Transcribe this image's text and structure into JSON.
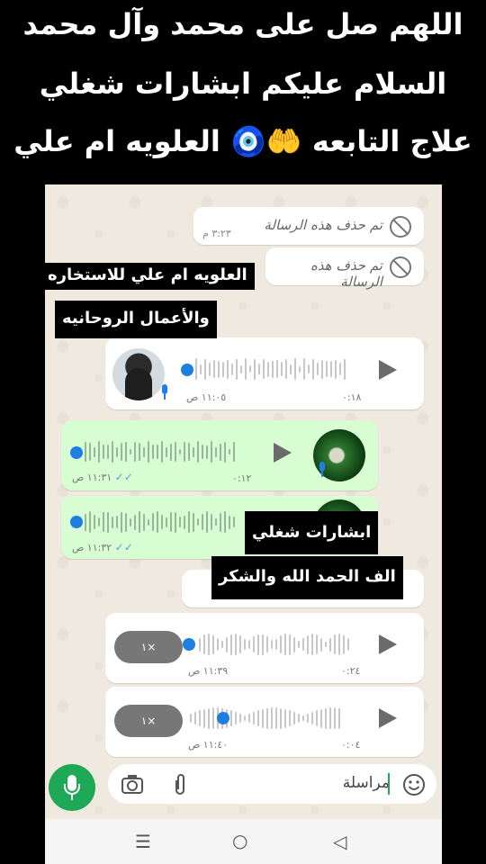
{
  "captions": {
    "line1": "اللهم صل على محمد وآل محمد",
    "line2": "السلام عليكم  ابشارات شغلي",
    "line3": "علاج التابعه 🤲🧿 العلويه ام علي"
  },
  "chat": {
    "deleted_messages": [
      {
        "text": "تم حذف هذه الرسالة",
        "time": "٣:٢٣ م"
      },
      {
        "text": "تم حذف هذه الرسالة",
        "time": ""
      }
    ],
    "voice_messages": [
      {
        "duration": "٠:١٨",
        "time": "١١:٠٥ ص",
        "sent": false,
        "progress": 0
      },
      {
        "duration": "٠:١٢",
        "time": "١١:٣١ ص",
        "sent": true,
        "progress": 0
      },
      {
        "duration": "",
        "time": "١١:٣٢ ص",
        "sent": true,
        "progress": 0
      },
      {
        "duration": "٠:٢٤",
        "time": "١١:٣٩ ص",
        "sent": false,
        "progress": 0,
        "speed": "١×"
      },
      {
        "duration": "٠:٠٤",
        "time": "١١:٤٠ ص",
        "sent": false,
        "progress": 0.25,
        "speed": "١×"
      }
    ]
  },
  "overlays": {
    "top_line1": "العلويه ام علي للاستخاره",
    "top_line2": "والأعمال الروحانيه",
    "mid_line1": "ابشارات شغلي",
    "mid_line2": "الف الحمد الله والشكر"
  },
  "composer": {
    "placeholder": "مراسلة"
  },
  "colors": {
    "accent": "#1fa855",
    "sent_bubble": "#d9fdd3",
    "read_ticks": "#4fa3e0"
  },
  "icons": [
    "mic-icon",
    "camera-icon",
    "paperclip-icon",
    "emoji-icon",
    "play-icon",
    "menu-icon",
    "home-icon",
    "back-icon",
    "ban-icon"
  ]
}
